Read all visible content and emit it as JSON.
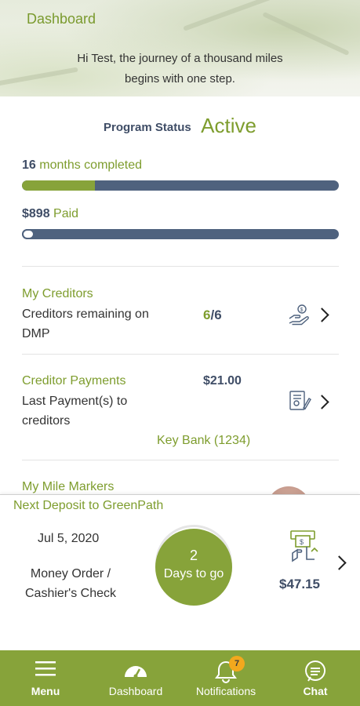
{
  "header": {
    "title": "Dashboard",
    "greeting_line1": "Hi Test, the journey of a thousand miles",
    "greeting_line2": "begins with one step."
  },
  "program_status": {
    "label": "Program Status",
    "value": "Active"
  },
  "progress": {
    "months_value": "16",
    "months_label": "months completed",
    "months_fraction": 0.23,
    "paid_value": "$898",
    "paid_label": "Paid",
    "paid_fraction": 0.04
  },
  "creditors": {
    "title": "My Creditors",
    "text_line1": "Creditors remaining on",
    "text_line2": "DMP",
    "remaining": "6",
    "total": "/6",
    "icon": "hand-money-icon"
  },
  "payments": {
    "title": "Creditor Payments",
    "text_line1": "Last Payment(s) to",
    "text_line2": "creditors",
    "amount": "$21.00",
    "bank": "Key Bank (1234)",
    "icon": "document-check-icon"
  },
  "mile_markers": {
    "title": "My Mile Markers"
  },
  "deposit": {
    "title": "Next Deposit to GreenPath",
    "date": "Jul 5, 2020",
    "method_line1": "Money Order /",
    "method_line2": "Cashier's Check",
    "days_value": "2",
    "days_label": "Days to go",
    "amount": "$47.15",
    "icon": "atm-deposit-icon"
  },
  "tabs": {
    "menu": "Menu",
    "dashboard": "Dashboard",
    "notifications": "Notifications",
    "notification_count": "7",
    "chat": "Chat"
  },
  "colors": {
    "brand_green": "#87a33a",
    "navy": "#4f627e",
    "badge": "#f2a81d"
  }
}
